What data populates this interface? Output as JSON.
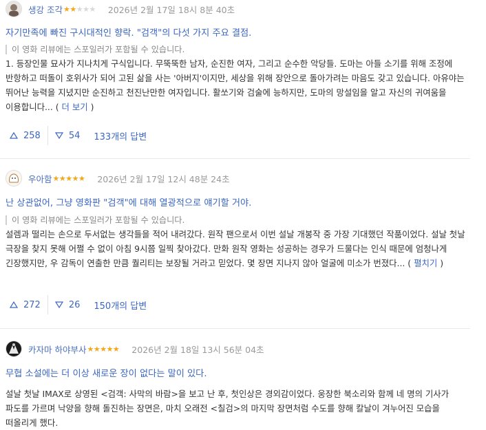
{
  "reviews": [
    {
      "username": "생강 조각",
      "rating": 2,
      "stars_on": "★★",
      "stars_off": "★★★",
      "datetime": "2026년 2월 17일 18시 8분 40초",
      "title": "자기만족에 빠진 구시대적인 향락. \"검객\"의 다섯 가지 주요 결점.",
      "spoiler_notice": "이 영화 리뷰에는 스포일러가 포함될 수 있습니다.",
      "body": "1. 등장인물 묘사가 지나치게 구식입니다. 무뚝뚝한 남자, 순진한 여자, 그리고 순수한 악당들. 도마는 아들 소기를 위해 조정에 반항하고 떠돌이 호위사가 되어 고된 삶을 사는 '아버지'이지만, 세상을 위해 장안으로 돌아가려는 마음도 갖고 있습니다. 아유야는 뛰어난 능력을 지녔지만 순진하고 천진난만한 여자입니다. 활쏘기와 검술에 능하지만, 도마의 망설임을 알고 자신의 귀여움을 이용합니다... ( ",
      "more": "더 보기",
      "close": " )",
      "upvotes": "258",
      "downvotes": "54",
      "replies": "133개의 답변"
    },
    {
      "username": "우아함",
      "rating": 5,
      "stars_on": "★★★★★",
      "stars_off": "",
      "datetime": "2026년 2월 17일 12시 48분 24초",
      "title": "난 상관없어, 그냥 영화판 \"검객\"에 대해 열광적으로 얘기할 거야.",
      "spoiler_notice": "이 영화 리뷰에는 스포일러가 포함될 수 있습니다.",
      "body": "설렘과 떨리는 손으로 두서없는 생각들을 적어 내려갔다. 원작 팬으로서 이번 설날 개봉작 중 가장 기대했던 작품이었다. 설날 첫날 극장을 찾지 못해 어쩔 수 없이 아침 9시쯤 일찍 찾아갔다. 만화 원작 영화는 성공하는 경우가 드물다는 인식 때문에 엄청나게 긴장했지만, 우 감독이 연출한 만큼 퀄리티는 보장될 거라고 믿었다. 몇 장면 지나지 않아 얼굴에 미소가 번졌다... ( ",
      "more": "펼치기",
      "close": " )",
      "upvotes": "272",
      "downvotes": "26",
      "replies": "150개의 답변"
    },
    {
      "username": "카자마 하야부사",
      "rating": 5,
      "stars_on": "★★★★★",
      "stars_off": "",
      "datetime": "2026년 2월 18일 13시 56분 04초",
      "title": "무협 소설에는 더 이상 새로운 장이 없다는 말이 있다.",
      "body": "설날 첫날 IMAX로 상영된 <검객: 사막의 바람>을 보고 난 후, 첫인상은 경외감이었다. 웅장한 북소리와 함께 네 명의 기사가 파도를 가르며 낙양을 향해 돌진하는 장면은, 마치 오래전 <칠검>의 마지막 장면처럼 수도를 향해 칼날이 겨누어진 모습을 떠올리게 했다."
    }
  ]
}
